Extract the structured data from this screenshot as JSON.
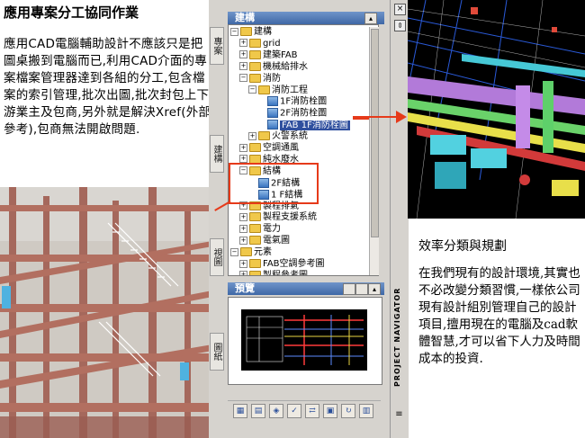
{
  "left": {
    "title": "應用專案分工協同作業",
    "body": "應用CAD電腦輔助設計不應該只是把圖桌搬到電腦而已,利用CAD介面的專案檔案管理器達到各組的分工,包含檔案的索引管理,批次出圖,批次封包上下游業主及包商,另外就是解決Xref(外部參考),包商無法開啟問題."
  },
  "right": {
    "title": "效率分類與規劃",
    "body": "在我們現有的設計環境,其實也不必改變分類習慣,一樣依公司現有設計組別管理自己的設計項目,擅用現在的電腦及cad軟體智慧,才可以省下人力及時間成本的投資."
  },
  "navigator": {
    "tree_title": "建構",
    "preview_title": "預覽",
    "vertical_label": "PROJECT NAVIGATOR",
    "side_tabs": [
      "專案",
      "建構",
      "視圖",
      "圖紙"
    ],
    "tree": [
      {
        "label": "建構",
        "level": 0,
        "type": "folder",
        "expander": "−"
      },
      {
        "label": "grid",
        "level": 1,
        "type": "folder",
        "expander": "+"
      },
      {
        "label": "建築FAB",
        "level": 1,
        "type": "folder",
        "expander": "+"
      },
      {
        "label": "機械給排水",
        "level": 1,
        "type": "folder",
        "expander": "+"
      },
      {
        "label": "消防",
        "level": 1,
        "type": "folder",
        "expander": "−"
      },
      {
        "label": "消防工程",
        "level": 2,
        "type": "folder",
        "expander": "−"
      },
      {
        "label": "1F消防栓圖",
        "level": 3,
        "type": "doc",
        "expander": ""
      },
      {
        "label": "2F消防栓圖",
        "level": 3,
        "type": "doc",
        "expander": ""
      },
      {
        "label": "FAB 1F消防栓圖",
        "level": 3,
        "type": "doc",
        "expander": "",
        "selected": true
      },
      {
        "label": "火警系統",
        "level": 2,
        "type": "folder",
        "expander": "+"
      },
      {
        "label": "空調通風",
        "level": 1,
        "type": "folder",
        "expander": "+"
      },
      {
        "label": "純水廢水",
        "level": 1,
        "type": "folder",
        "expander": "+"
      },
      {
        "label": "結構",
        "level": 1,
        "type": "folder",
        "expander": "−"
      },
      {
        "label": "2F結構",
        "level": 2,
        "type": "doc",
        "expander": ""
      },
      {
        "label": "1 F結構",
        "level": 2,
        "type": "doc",
        "expander": ""
      },
      {
        "label": "製程排氣",
        "level": 1,
        "type": "folder",
        "expander": "+"
      },
      {
        "label": "製程支援系統",
        "level": 1,
        "type": "folder",
        "expander": "+"
      },
      {
        "label": "電力",
        "level": 1,
        "type": "folder",
        "expander": "+"
      },
      {
        "label": "電氣圖",
        "level": 1,
        "type": "folder",
        "expander": "+"
      },
      {
        "label": "元素",
        "level": 0,
        "type": "folder",
        "expander": "−"
      },
      {
        "label": "FAB空調參考圖",
        "level": 1,
        "type": "folder",
        "expander": "+"
      },
      {
        "label": "製程參考圖",
        "level": 1,
        "type": "folder",
        "expander": "+"
      }
    ],
    "toolbar_icons": [
      "add-view-icon",
      "properties-icon",
      "regen-icon",
      "check-icon",
      "repath-icon",
      "etransmit-icon",
      "refresh-icon",
      "publish-icon"
    ]
  },
  "colors": {
    "highlight_red": "#e63a1a",
    "selection_blue": "#2f4f9e",
    "panel_gray": "#d6d3ce",
    "header_blue": "#3f68a6"
  }
}
